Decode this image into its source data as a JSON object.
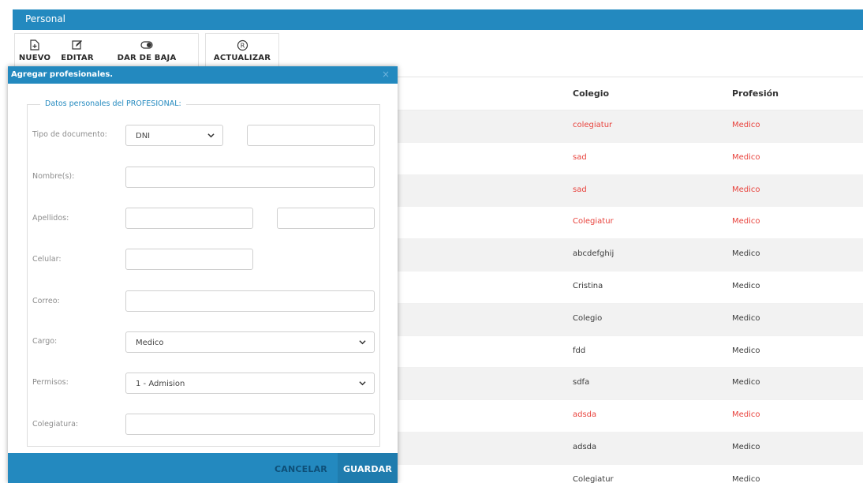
{
  "panel": {
    "title": "Personal"
  },
  "toolbar": {
    "nuevo": "NUEVO",
    "editar": "EDITAR",
    "dar_de_baja": "DAR DE BAJA",
    "actualizar": "ACTUALIZAR"
  },
  "table": {
    "headers": {
      "colegio": "Colegio",
      "profesion": "Profesión"
    },
    "rows": [
      {
        "colegio": "colegiatur",
        "profesion": "Medico",
        "highlight": true
      },
      {
        "colegio": "sad",
        "profesion": "Medico",
        "highlight": true
      },
      {
        "colegio": "sad",
        "profesion": "Medico",
        "highlight": true
      },
      {
        "colegio": "Colegiatur",
        "profesion": "Medico",
        "highlight": true
      },
      {
        "colegio": "abcdefghij",
        "profesion": "Medico",
        "highlight": false
      },
      {
        "colegio": "Cristina",
        "profesion": "Medico",
        "highlight": false
      },
      {
        "colegio": "Colegio",
        "profesion": "Medico",
        "highlight": false
      },
      {
        "colegio": "fdd",
        "profesion": "Medico",
        "highlight": false
      },
      {
        "colegio": "sdfa",
        "profesion": "Medico",
        "highlight": false
      },
      {
        "colegio": "adsda",
        "profesion": "Medico",
        "highlight": true
      },
      {
        "colegio": "adsda",
        "profesion": "Medico",
        "highlight": false
      },
      {
        "colegio": "Colegiatur",
        "profesion": "Medico",
        "highlight": false
      }
    ]
  },
  "modal": {
    "title": "Agregar profesionales.",
    "close": "×",
    "legend": "Datos personales del PROFESIONAL:",
    "labels": {
      "tipo_documento": "Tipo de documento:",
      "nombres": "Nombre(s):",
      "apellidos": "Apellidos:",
      "celular": "Celular:",
      "correo": "Correo:",
      "cargo": "Cargo:",
      "permisos": "Permisos:",
      "colegiatura": "Colegiatura:"
    },
    "values": {
      "tipo_documento": "DNI",
      "numero_documento": "",
      "nombres": "",
      "apellido_paterno": "",
      "apellido_materno": "",
      "celular": "",
      "correo": "",
      "cargo": "Medico",
      "permisos": "1 - Admision",
      "colegiatura": ""
    },
    "buttons": {
      "cancel": "CANCELAR",
      "save": "GUARDAR"
    }
  },
  "colors": {
    "accent": "#2389bf",
    "highlight_text": "#e8423c"
  }
}
